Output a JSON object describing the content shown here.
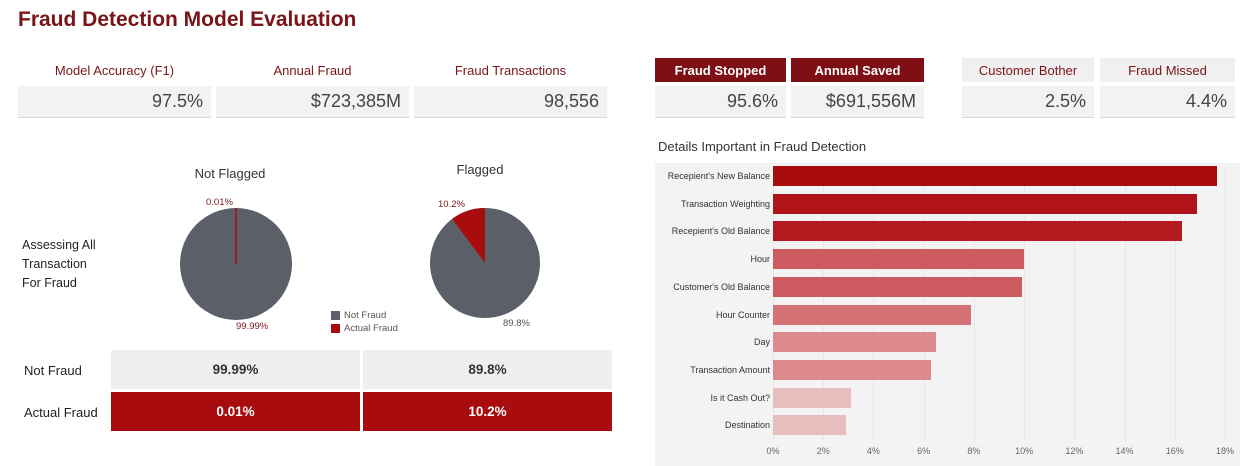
{
  "title": "Fraud Detection Model Evaluation",
  "kpis": [
    {
      "label": "Model Accuracy (F1)",
      "value": "97.5%",
      "style": "plain"
    },
    {
      "label": "Annual Fraud",
      "value": "$723,385M",
      "style": "plain"
    },
    {
      "label": "Fraud Transactions",
      "value": "98,556",
      "style": "plain"
    },
    {
      "label": "Fraud Stopped",
      "value": "95.6%",
      "style": "dark"
    },
    {
      "label": "Annual Saved",
      "value": "$691,556M",
      "style": "dark"
    },
    {
      "label": "Customer Bother",
      "value": "2.5%",
      "style": "grey"
    },
    {
      "label": "Fraud Missed",
      "value": "4.4%",
      "style": "grey"
    }
  ],
  "assessing_label": [
    "Assessing All",
    "Transaction",
    "For Fraud"
  ],
  "pies": {
    "not_flagged": {
      "title": "Not Flagged",
      "fraud_pct": 0.01,
      "fraud_label": "0.01%",
      "not_fraud_label": "99.99%"
    },
    "flagged": {
      "title": "Flagged",
      "fraud_pct": 10.2,
      "fraud_label": "10.2%",
      "not_fraud_label": "89.8%"
    }
  },
  "legend": [
    {
      "label": "Not Fraud",
      "color": "#5b5f68"
    },
    {
      "label": "Actual Fraud",
      "color": "#a80c0e"
    }
  ],
  "matrix": {
    "rows": [
      {
        "label": "Not Fraud",
        "cells": [
          "99.99%",
          "89.8%"
        ]
      },
      {
        "label": "Actual Fraud",
        "cells": [
          "0.01%",
          "10.2%"
        ]
      }
    ]
  },
  "chart_data": {
    "type": "bar",
    "orientation": "horizontal",
    "title": "Details Important in Fraud Detection",
    "categories": [
      "Recepient's New Balance",
      "Transaction Weighting",
      "Recepient's Old Balance",
      "Hour",
      "Customer's Old Balance",
      "Hour Counter",
      "Day",
      "Transaction Amount",
      "Is it Cash Out?",
      "Destination"
    ],
    "values": [
      17.7,
      16.9,
      16.3,
      10.0,
      9.9,
      7.9,
      6.5,
      6.3,
      3.1,
      2.9
    ],
    "value_unit": "%",
    "xlim": [
      0,
      18
    ],
    "ticks": [
      "0%",
      "2%",
      "4%",
      "6%",
      "8%",
      "10%",
      "12%",
      "14%",
      "16%",
      "18%"
    ],
    "tick_values": [
      0,
      2,
      4,
      6,
      8,
      10,
      12,
      14,
      16,
      18
    ],
    "bar_colors": [
      "#a80c0e",
      "#b0141a",
      "#b31a20",
      "#cc5a5e",
      "#cc5a5e",
      "#d57275",
      "#dc8a8d",
      "#dc8a8d",
      "#e8bdbe",
      "#e8bdbe"
    ]
  }
}
